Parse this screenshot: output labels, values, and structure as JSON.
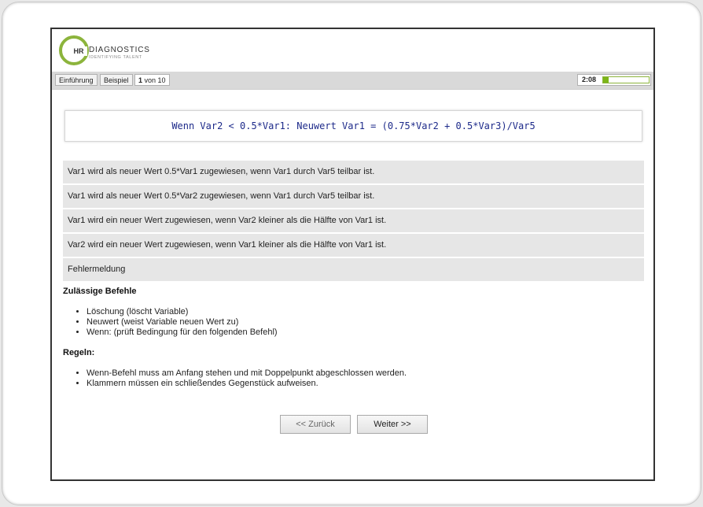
{
  "logo": {
    "mark": "HR",
    "name": "DIAGNOSTICS",
    "tagline": "IDENTIFYING TALENT"
  },
  "toolbar": {
    "intro_label": "Einführung",
    "example_label": "Beispiel",
    "page_current": "1",
    "page_of": "von 10",
    "timer": "2:08",
    "timer_progress": 0.12
  },
  "question": {
    "formula": "Wenn Var2 < 0.5*Var1: Neuwert Var1 = (0.75*Var2 + 0.5*Var3)/Var5"
  },
  "answers": [
    "Var1 wird als neuer Wert 0.5*Var1 zugewiesen, wenn Var1 durch Var5 teilbar ist.",
    "Var1 wird als neuer Wert 0.5*Var2 zugewiesen, wenn Var1 durch Var5 teilbar ist.",
    "Var1 wird ein neuer Wert zugewiesen, wenn Var2 kleiner als die Hälfte von Var1 ist.",
    "Var2 wird ein neuer Wert zugewiesen, wenn Var1 kleiner als die Hälfte von Var1 ist.",
    "Fehlermeldung"
  ],
  "commands": {
    "title": "Zulässige Befehle",
    "items": [
      "Löschung (löscht Variable)",
      "Neuwert (weist Variable neuen Wert zu)",
      "Wenn: (prüft Bedingung für den folgenden Befehl)"
    ]
  },
  "rules": {
    "title": "Regeln:",
    "items": [
      "Wenn-Befehl muss am Anfang stehen und mit Doppelpunkt abgeschlossen werden.",
      "Klammern müssen ein schließendes Gegenstück aufweisen."
    ]
  },
  "nav": {
    "back_label": "<< Zurück",
    "next_label": "Weiter >>"
  },
  "colors": {
    "brand_green": "#8cb43c",
    "formula_blue": "#1d2a8a",
    "answer_bg": "#e6e6e6"
  }
}
